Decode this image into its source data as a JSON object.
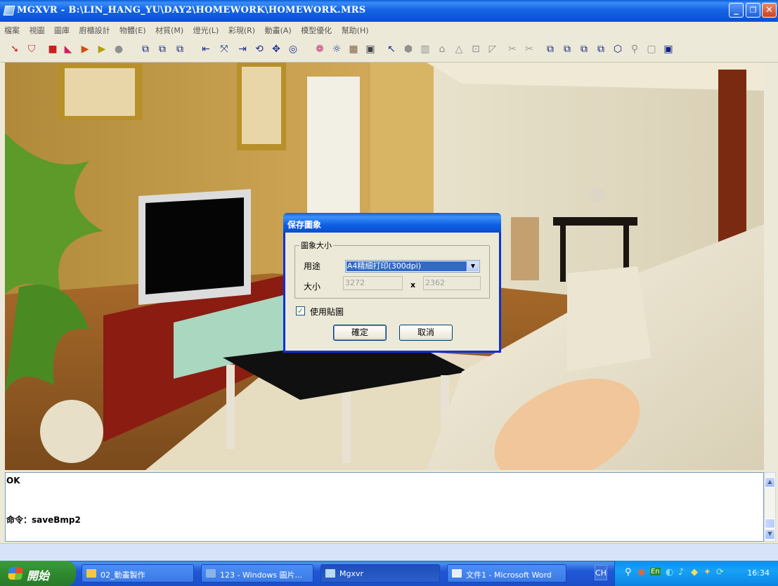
{
  "window": {
    "title": "MGXVR - B:\\LIN_HANG_YU\\DAY2\\HOMEWORK\\HOMEWORK.MRS",
    "minimize": "_",
    "restore": "❐",
    "close": "✕"
  },
  "menu": [
    "檔案",
    "視圖",
    "圖庫",
    "廚櫃設計",
    "物體(E)",
    "材質(M)",
    "燈光(L)",
    "彩現(R)",
    "動畫(A)",
    "模型優化",
    "幫助(H)"
  ],
  "toolbar_icons": [
    "import-icon",
    "filter-icon",
    "stop-icon",
    "color-a-icon",
    "color-b-icon",
    "color-c-icon",
    "sphere-icon",
    "box-1-icon",
    "box-2-icon",
    "box-3-icon",
    "arrow-left-icon",
    "expand-icon",
    "arrow-right-icon",
    "rotate-icon",
    "move-icon",
    "target-icon",
    "color-wheel-icon",
    "light-icon",
    "photo-icon",
    "frame-icon",
    "cursor-icon",
    "cube-icon",
    "wall-icon",
    "roof-icon",
    "triangle-icon",
    "wire-icon",
    "slope-icon",
    "tool-a-icon",
    "tool-b-icon",
    "cube-a-icon",
    "cube-b-icon",
    "cube-c-icon",
    "cube-d-icon",
    "cube-e-icon",
    "zoom-icon",
    "view-a-icon",
    "view-b-icon"
  ],
  "dialog": {
    "title": "保存圖象",
    "group_label": "圖象大小",
    "purpose_label": "用途",
    "purpose_value": "A4精細打印(300dpi)",
    "size_label": "大小",
    "width": "3272",
    "x_sep": "x",
    "height": "2362",
    "use_texture_label": "使用貼圖",
    "use_texture_checked": true,
    "ok_label": "確定",
    "cancel_label": "取消"
  },
  "command": {
    "line1": "OK",
    "line2": "命令：saveBmp2"
  },
  "taskbar": {
    "start": "開始",
    "tasks": [
      {
        "label": "02_動畫製作"
      },
      {
        "label": "123 - Windows 圖片..."
      },
      {
        "label": "Mgxvr"
      },
      {
        "label": "文件1 - Microsoft Word"
      }
    ],
    "lang": "CH",
    "clock": "16:34"
  },
  "colors": {
    "accent": "#0a5fd8",
    "taskbar": "#2157d7",
    "start": "#2f8a2f"
  }
}
